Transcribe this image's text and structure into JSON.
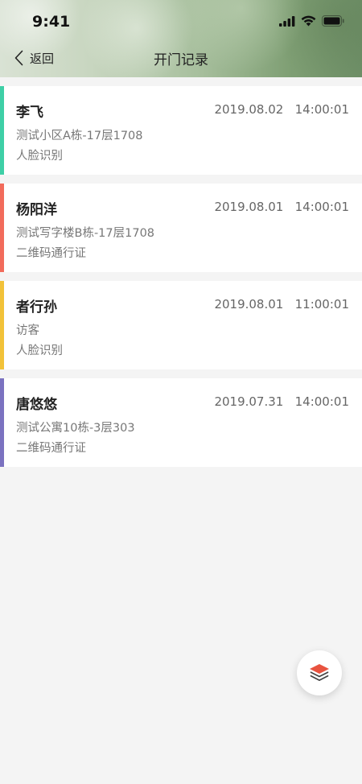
{
  "status_bar": {
    "time": "9:41",
    "icons": [
      "signal-icon",
      "wifi-icon",
      "battery-icon"
    ]
  },
  "nav": {
    "back_label": "返回",
    "title": "开门记录"
  },
  "records": [
    {
      "name": "李飞",
      "datetime": "2019.08.02   14:00:01",
      "location": "测试小区A栋-17层1708",
      "method": "人脸识别",
      "accent": "#3ecfa6"
    },
    {
      "name": "杨阳洋",
      "datetime": "2019.08.01   14:00:01",
      "location": "测试写字楼B栋-17层1708",
      "method": "二维码通行证",
      "accent": "#f26b5b"
    },
    {
      "name": "者行孙",
      "datetime": "2019.08.01   11:00:01",
      "location": "访客",
      "method": "人脸识别",
      "accent": "#f2c239"
    },
    {
      "name": "唐悠悠",
      "datetime": "2019.07.31   14:00:01",
      "location": "测试公寓10栋-3层303",
      "method": "二维码通行证",
      "accent": "#7b72c0"
    }
  ],
  "fab": {
    "icon": "layers-icon",
    "color": "#e8533f"
  }
}
